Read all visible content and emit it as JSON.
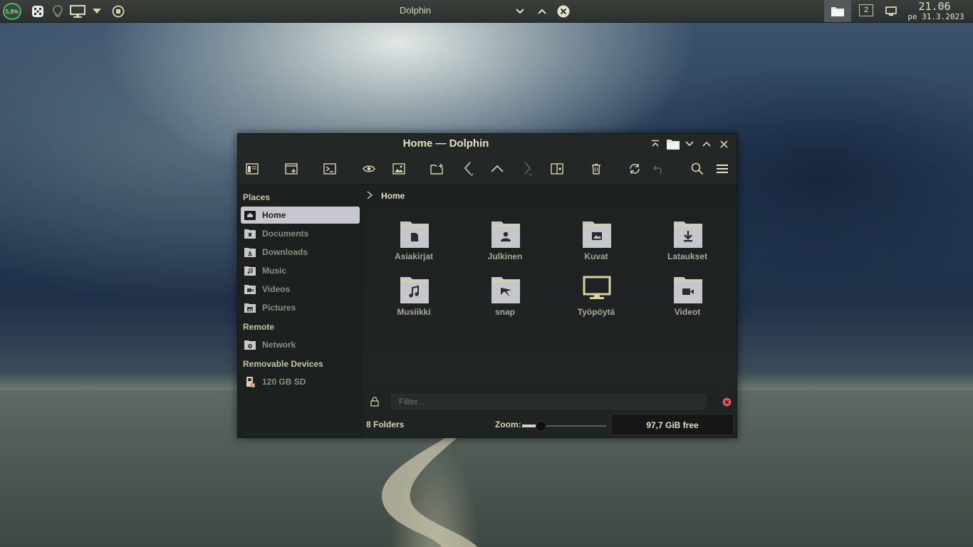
{
  "topbar": {
    "cpu_percent": "5,8%",
    "active_title": "Dolphin",
    "desktop_number": "2",
    "clock_time": "21.06",
    "clock_date": "pe 31.3.2023"
  },
  "window": {
    "title": "Home — Dolphin"
  },
  "places": {
    "section_places": "Places",
    "section_remote": "Remote",
    "section_removable": "Removable Devices",
    "items": [
      {
        "label": "Home",
        "icon": "home-folder-icon",
        "selected": true
      },
      {
        "label": "Documents",
        "icon": "documents-folder-icon"
      },
      {
        "label": "Downloads",
        "icon": "downloads-folder-icon"
      },
      {
        "label": "Music",
        "icon": "music-folder-icon"
      },
      {
        "label": "Videos",
        "icon": "videos-folder-icon"
      },
      {
        "label": "Pictures",
        "icon": "pictures-folder-icon"
      }
    ],
    "remote": [
      {
        "label": "Network",
        "icon": "network-folder-icon"
      }
    ],
    "removable": [
      {
        "label": "120 GB SD",
        "icon": "sd-card-icon"
      }
    ]
  },
  "breadcrumb": {
    "current": "Home"
  },
  "files": [
    {
      "label": "Asiakirjat",
      "icon": "documents-folder-icon"
    },
    {
      "label": "Julkinen",
      "icon": "public-folder-icon"
    },
    {
      "label": "Kuvat",
      "icon": "pictures-folder-icon"
    },
    {
      "label": "Lataukset",
      "icon": "downloads-folder-icon"
    },
    {
      "label": "Musiikki",
      "icon": "music-folder-icon"
    },
    {
      "label": "snap",
      "icon": "snap-folder-icon"
    },
    {
      "label": "Työpöytä",
      "icon": "desktop-monitor-icon"
    },
    {
      "label": "Videot",
      "icon": "videos-folder-icon"
    }
  ],
  "filter": {
    "placeholder": "Filter..."
  },
  "status": {
    "count": "8 Folders",
    "zoom_label": "Zoom:",
    "zoom_level": 0.22,
    "free_space": "97,7 GiB free"
  },
  "colors": {
    "accent": "#d8d4b0",
    "window_bg": "#1f2322",
    "selection": "#c6c8ce",
    "close_red": "#e05a5a"
  }
}
